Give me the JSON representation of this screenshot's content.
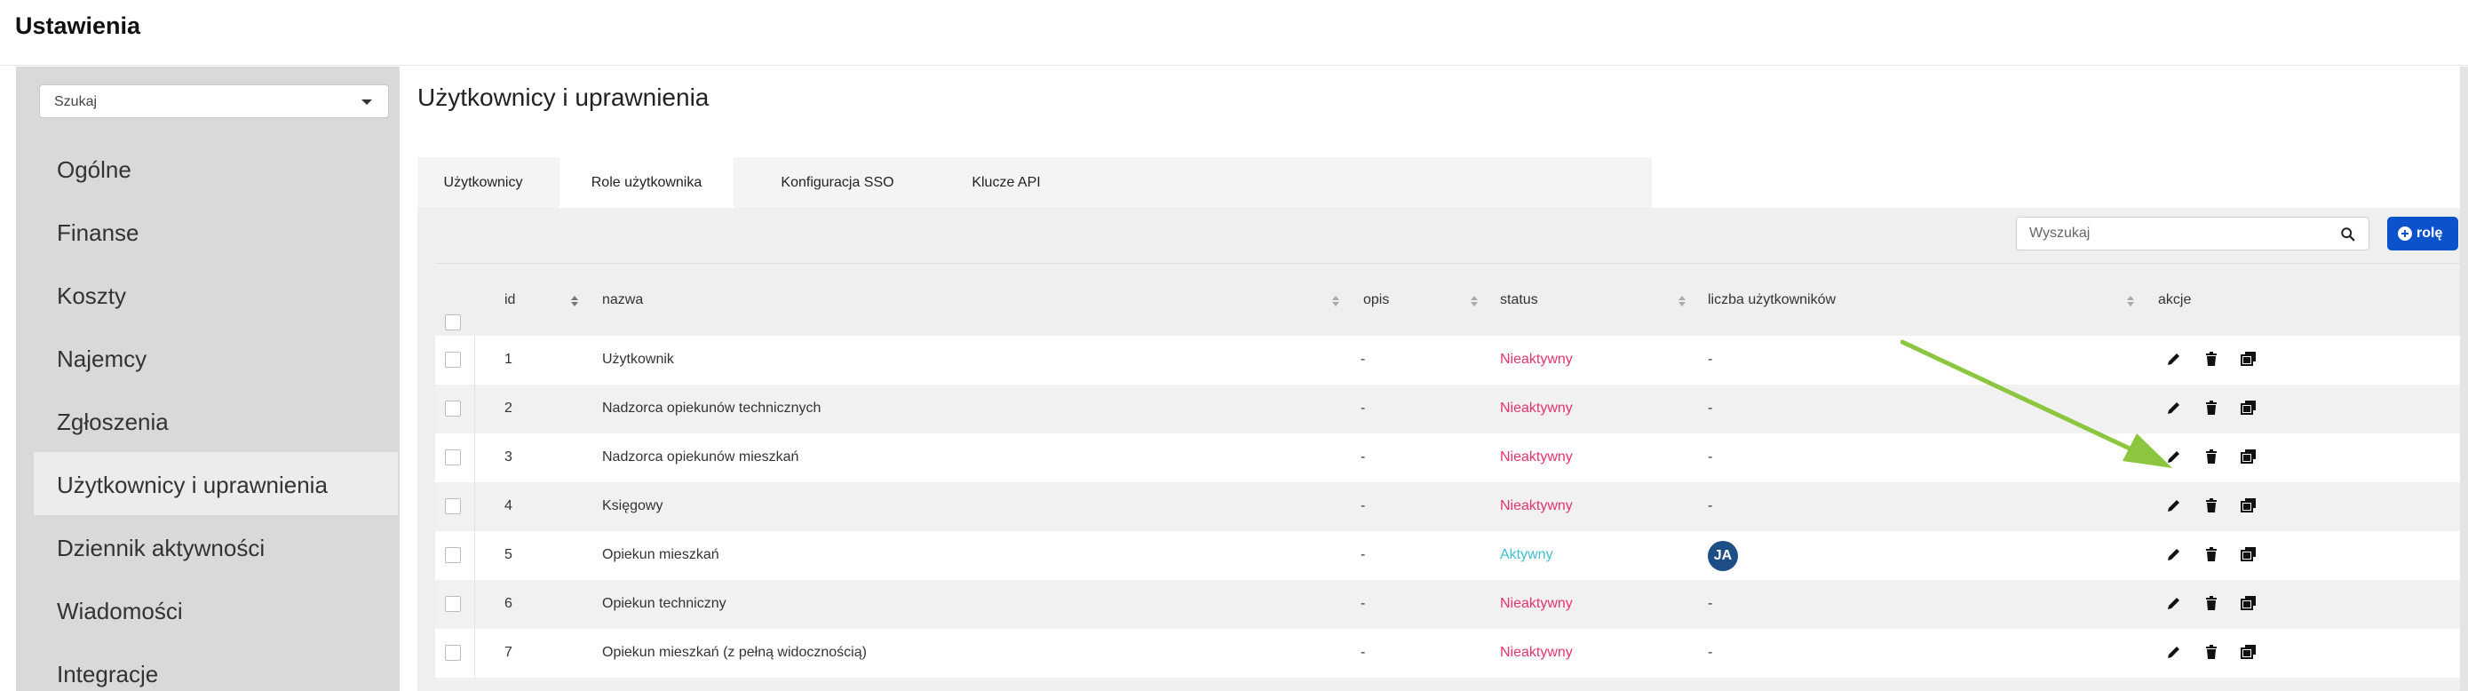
{
  "app": {
    "title": "Ustawienia"
  },
  "sidebar": {
    "search_placeholder": "Szukaj",
    "items": [
      {
        "label": "Ogólne",
        "active": false
      },
      {
        "label": "Finanse",
        "active": false
      },
      {
        "label": "Koszty",
        "active": false
      },
      {
        "label": "Najemcy",
        "active": false
      },
      {
        "label": "Zgłoszenia",
        "active": false
      },
      {
        "label": "Użytkownicy i uprawnienia",
        "active": true
      },
      {
        "label": "Dziennik aktywności",
        "active": false
      },
      {
        "label": "Wiadomości",
        "active": false
      },
      {
        "label": "Integracje",
        "active": false
      }
    ]
  },
  "main": {
    "heading": "Użytkownicy i uprawnienia",
    "tabs": [
      {
        "label": "Użytkownicy",
        "active": false
      },
      {
        "label": "Role użytkownika",
        "active": true
      },
      {
        "label": "Konfiguracja SSO",
        "active": false
      },
      {
        "label": "Klucze API",
        "active": false
      }
    ],
    "toolbar": {
      "search_placeholder": "Wyszukaj",
      "add_label": "rolę"
    },
    "table": {
      "columns": {
        "id": "id",
        "name": "nazwa",
        "description": "opis",
        "status": "status",
        "users": "liczba użytkowników",
        "actions": "akcje"
      },
      "rows": [
        {
          "id": "1",
          "name": "Użytkownik",
          "description": "-",
          "status": "Nieaktywny",
          "users": "-"
        },
        {
          "id": "2",
          "name": "Nadzorca opiekunów technicznych",
          "description": "-",
          "status": "Nieaktywny",
          "users": "-"
        },
        {
          "id": "3",
          "name": "Nadzorca opiekunów mieszkań",
          "description": "-",
          "status": "Nieaktywny",
          "users": "-"
        },
        {
          "id": "4",
          "name": "Księgowy",
          "description": "-",
          "status": "Nieaktywny",
          "users": "-"
        },
        {
          "id": "5",
          "name": "Opiekun mieszkań",
          "description": "-",
          "status": "Aktywny",
          "users": "JA"
        },
        {
          "id": "6",
          "name": "Opiekun techniczny",
          "description": "-",
          "status": "Nieaktywny",
          "users": "-"
        },
        {
          "id": "7",
          "name": "Opiekun mieszkań (z pełną widocznością)",
          "description": "-",
          "status": "Nieaktywny",
          "users": "-"
        }
      ]
    }
  },
  "colors": {
    "accent": "#0b52cc",
    "inactive": "#e8336d",
    "active": "#3fbfcf",
    "avatar": "#1d4f86",
    "annotation_arrow": "#8cc63f"
  }
}
